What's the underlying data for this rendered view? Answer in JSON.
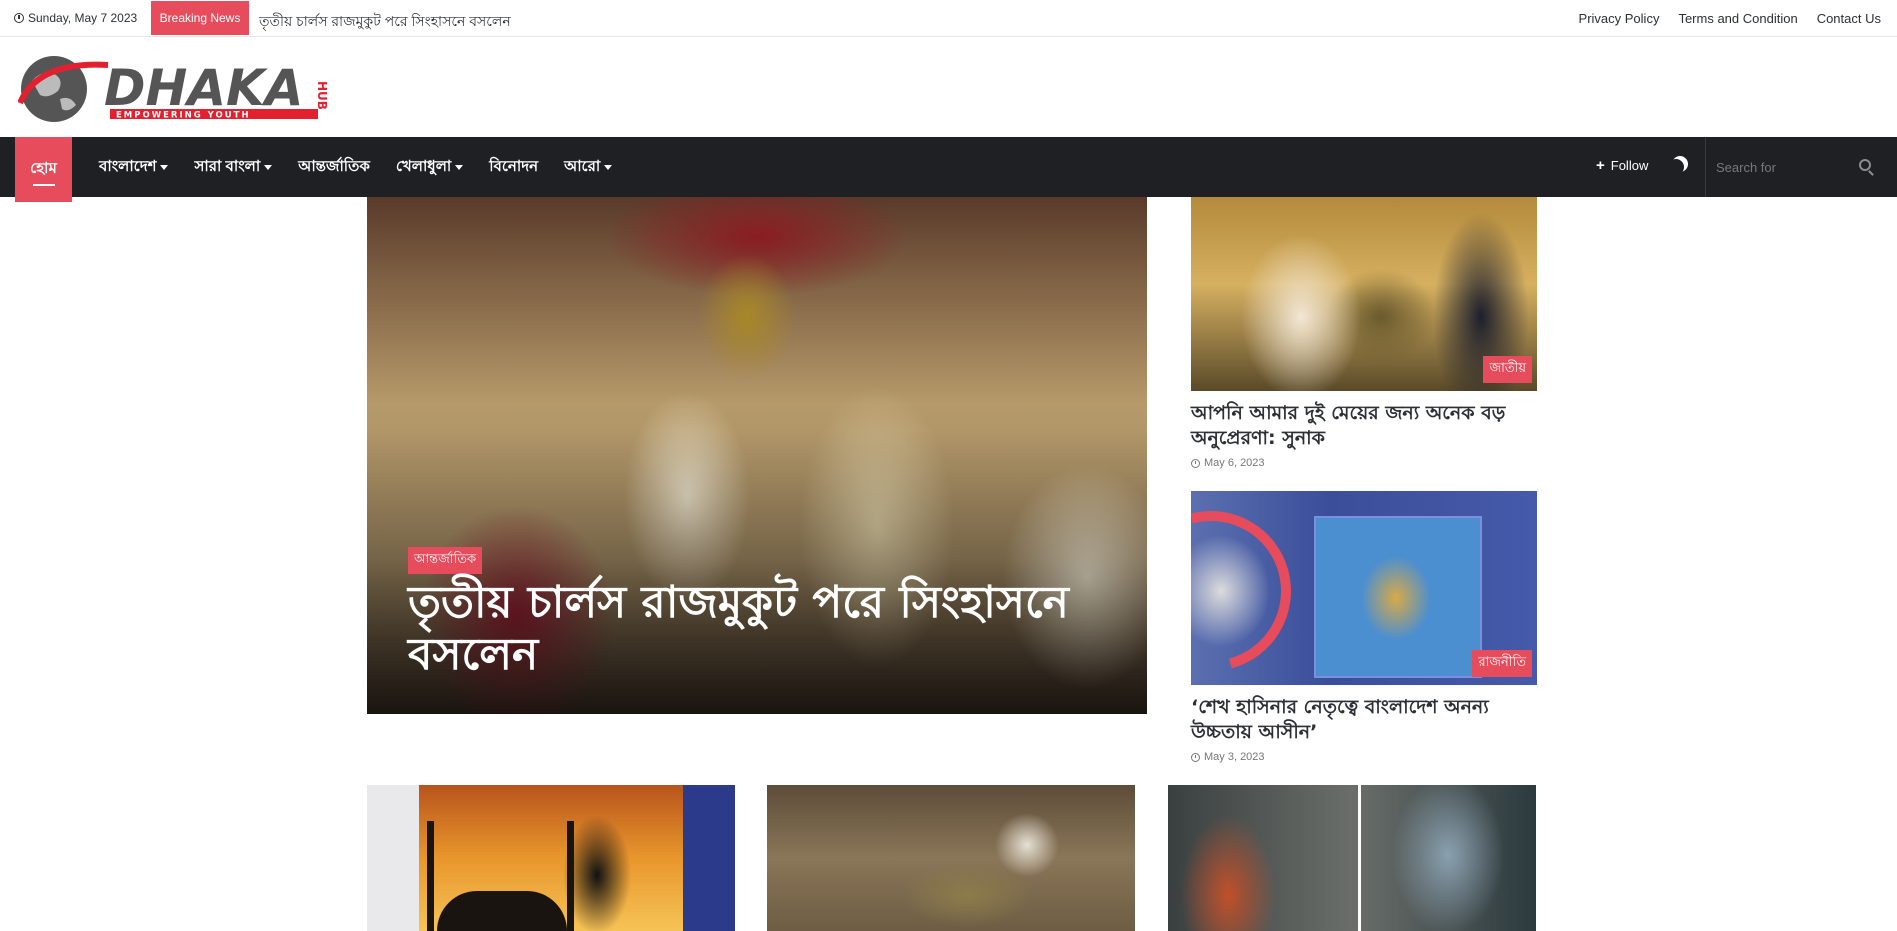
{
  "topbar": {
    "date": "Sunday, May 7 2023",
    "breaking_label": "Breaking News",
    "ticker_text": "তৃতীয় চার্লস রাজমুকুট পরে সিংহাসনে বসলেন",
    "links": [
      "Privacy Policy",
      "Terms and Condition",
      "Contact Us"
    ]
  },
  "logo": {
    "name": "DHAKA",
    "suffix": "HUB",
    "tagline": "EMPOWERING YOUTH"
  },
  "nav": {
    "home": "হোম",
    "items": [
      {
        "label": "বাংলাদেশ",
        "dropdown": true
      },
      {
        "label": "সারা বাংলা",
        "dropdown": true
      },
      {
        "label": "আন্তর্জাতিক",
        "dropdown": false
      },
      {
        "label": "খেলাধুলা",
        "dropdown": true
      },
      {
        "label": "বিনোদন",
        "dropdown": false
      },
      {
        "label": "আরো",
        "dropdown": true
      }
    ],
    "follow_label": "Follow",
    "search_placeholder": "Search for"
  },
  "hero": {
    "category": "আন্তর্জাতিক",
    "title": "তৃতীয় চার্লস রাজমুকুট পরে সিংহাসনে বসলেন"
  },
  "side_articles": [
    {
      "category": "জাতীয়",
      "title": "আপনি আমার দুই মেয়ের জন্য অনেক বড় অনুপ্রেরণা: সুনাক",
      "date": "May 6, 2023"
    },
    {
      "category": "রাজনীতি",
      "title": "‘শেখ হাসিনার নেতৃত্বে বাংলাদেশ অনন্য উচ্চতায় আসীন’",
      "date": "May 3, 2023"
    }
  ],
  "colors": {
    "accent": "#e74c5c",
    "nav_bg": "#1f2024"
  }
}
